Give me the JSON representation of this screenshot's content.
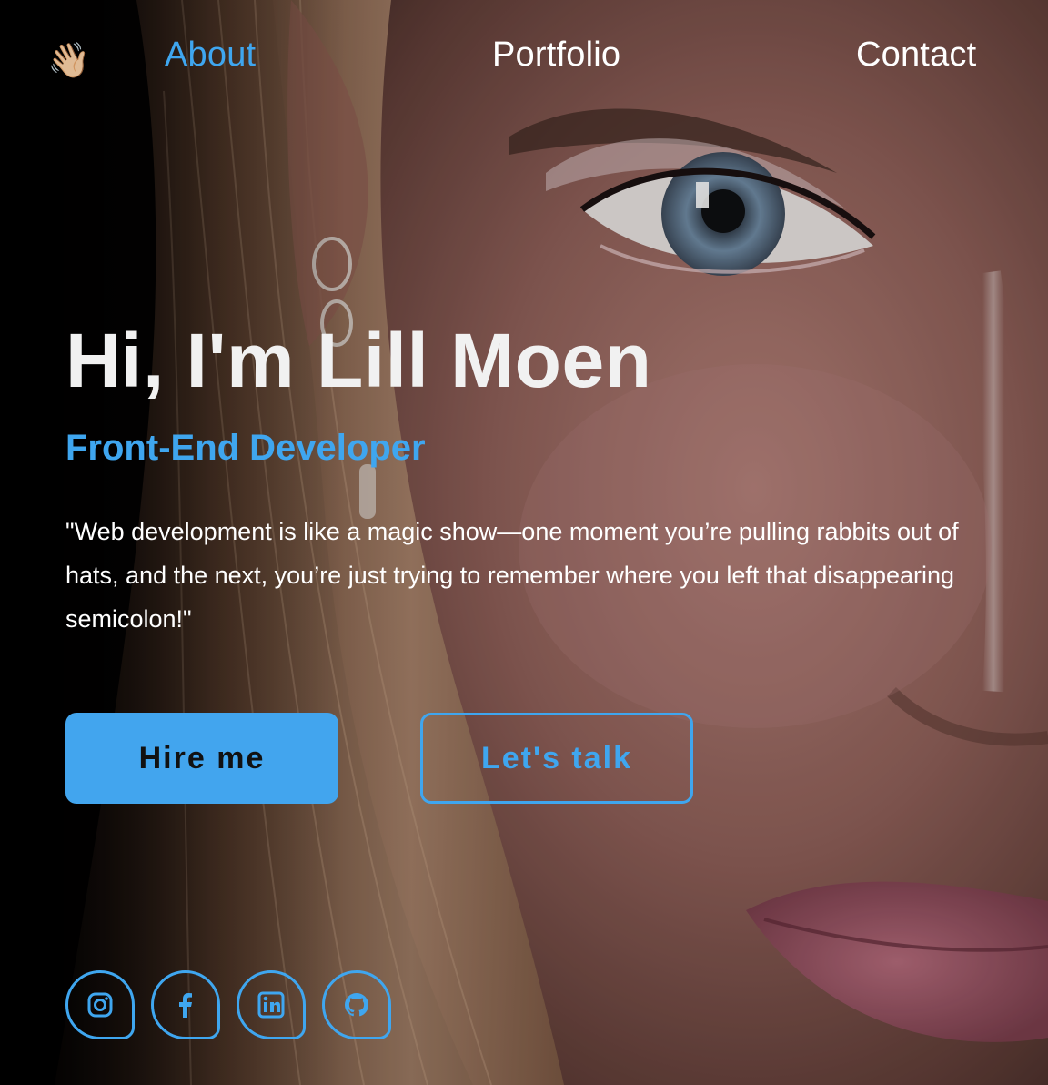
{
  "nav": {
    "emoji": "👋🏼",
    "links": [
      {
        "label": "About",
        "active": true
      },
      {
        "label": "Portfolio",
        "active": false
      },
      {
        "label": "Contact",
        "active": false
      }
    ]
  },
  "hero": {
    "title": "Hi, I'm Lill Moen",
    "subtitle": "Front-End Developer",
    "quote": "\"Web development is like a magic show—one moment you’re pulling rabbits out of hats, and the next, you’re just trying to remember where you left that disappearing semicolon!\""
  },
  "buttons": {
    "primary": "Hire me",
    "secondary": "Let's talk"
  },
  "social": [
    {
      "icon": "instagram-icon"
    },
    {
      "icon": "facebook-icon"
    },
    {
      "icon": "linkedin-icon"
    },
    {
      "icon": "github-icon"
    }
  ],
  "colors": {
    "accent": "#3fa6ef",
    "button_fill": "#42a5ee",
    "text": "#ffffff"
  }
}
